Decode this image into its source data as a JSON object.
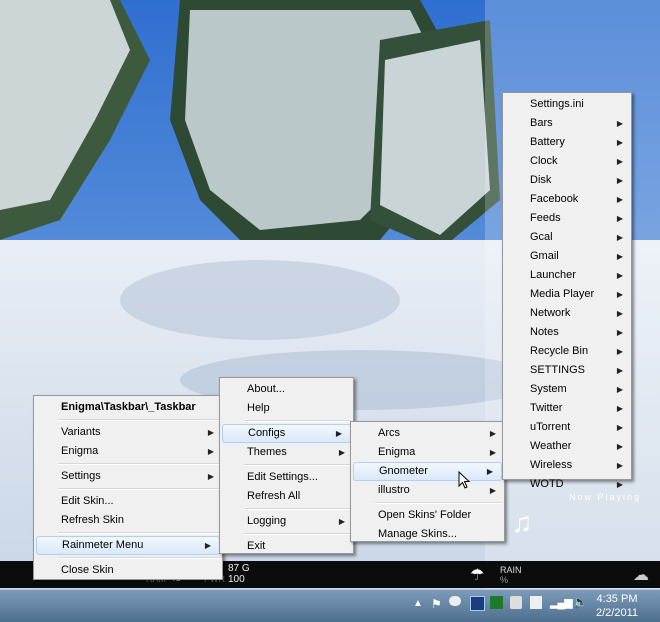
{
  "colors": {
    "menu_bg": "#f0f0f0",
    "highlight": "#d9e8fa",
    "taskbar": "#5e7e9d",
    "strip": "#0c0c0c"
  },
  "desktop": {
    "now_playing": "Now Playing",
    "music_icon": "music-note-icon"
  },
  "strip": {
    "ram_label": "RAM",
    "ram_value": "48",
    "pwr_label": "PWR",
    "pwr_value": "100",
    "disk_value": "87 G",
    "rain_label": "RAIN",
    "rain_value": "%"
  },
  "context_menu": {
    "title": "Enigma\\Taskbar\\_Taskbar",
    "items": [
      "Variants",
      "Enigma",
      "Settings",
      "Edit Skin...",
      "Refresh Skin",
      "Rainmeter Menu",
      "Close Skin"
    ]
  },
  "rainmeter_menu": {
    "items": [
      "About...",
      "Help",
      "Configs",
      "Themes",
      "Edit Settings...",
      "Refresh All",
      "Logging",
      "Exit"
    ]
  },
  "configs_menu": {
    "items": [
      "Arcs",
      "Enigma",
      "Gnometer",
      "illustro",
      "Open Skins' Folder",
      "Manage Skins..."
    ]
  },
  "gnometer_menu": {
    "items": [
      "Settings.ini",
      "Bars",
      "Battery",
      "Clock",
      "Disk",
      "Facebook",
      "Feeds",
      "Gcal",
      "Gmail",
      "Launcher",
      "Media Player",
      "Network",
      "Notes",
      "Recycle Bin",
      "SETTINGS",
      "System",
      "Twitter",
      "uTorrent",
      "Weather",
      "Wireless",
      "WOTD"
    ]
  },
  "clock": {
    "time": "4:35 PM",
    "date": "2/2/2011"
  }
}
